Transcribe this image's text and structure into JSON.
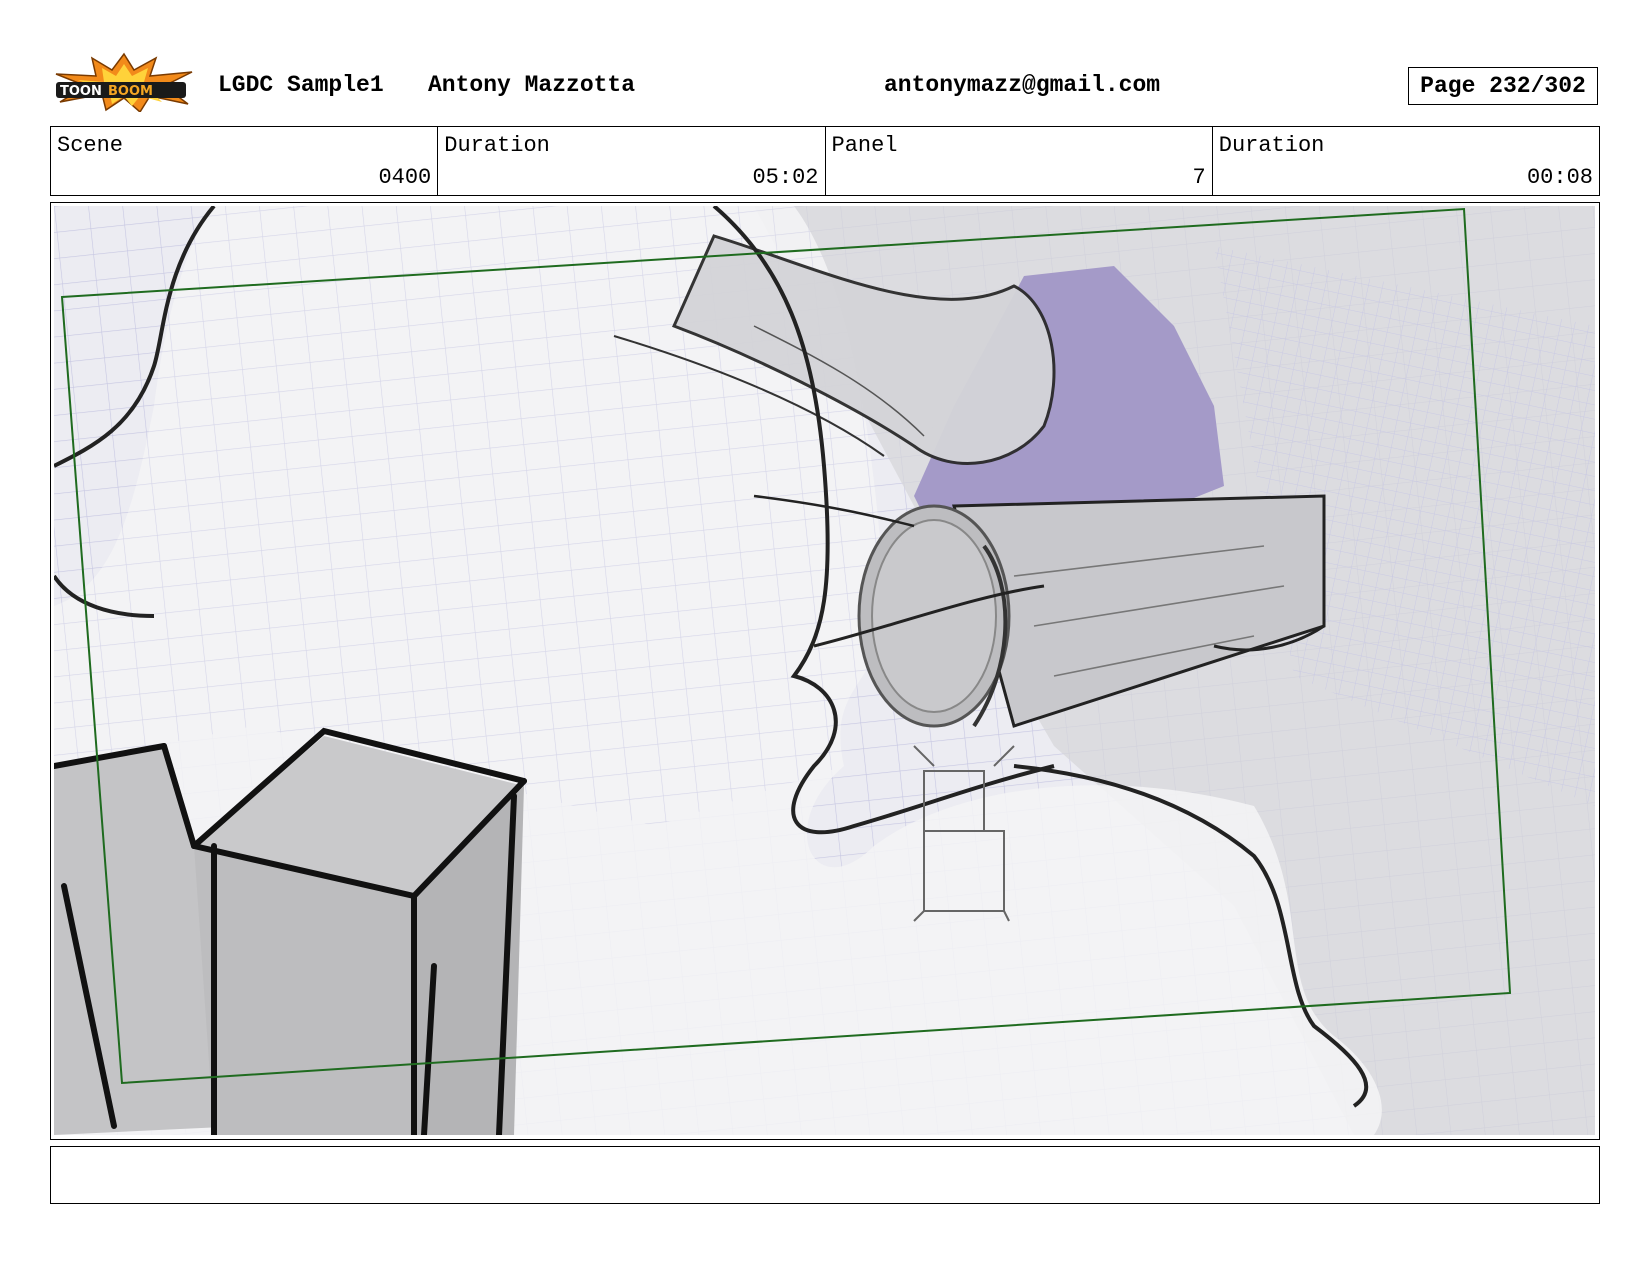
{
  "header": {
    "logo_text": "TOONBOOM",
    "project": "LGDC Sample1",
    "author": "Antony Mazzotta",
    "email": "antonymazz@gmail.com",
    "page": "Page 232/302"
  },
  "info": [
    {
      "label": "Scene",
      "value": "0400"
    },
    {
      "label": "Duration",
      "value": "05:02"
    },
    {
      "label": "Panel",
      "value": "7"
    },
    {
      "label": "Duration",
      "value": "00:08"
    }
  ],
  "colors": {
    "camera_frame": "#1f6b1f",
    "sky_purple": "#a49ac8",
    "grid_lines": "#b8b8dc",
    "logo_orange": "#f28a1a"
  },
  "notes": ""
}
